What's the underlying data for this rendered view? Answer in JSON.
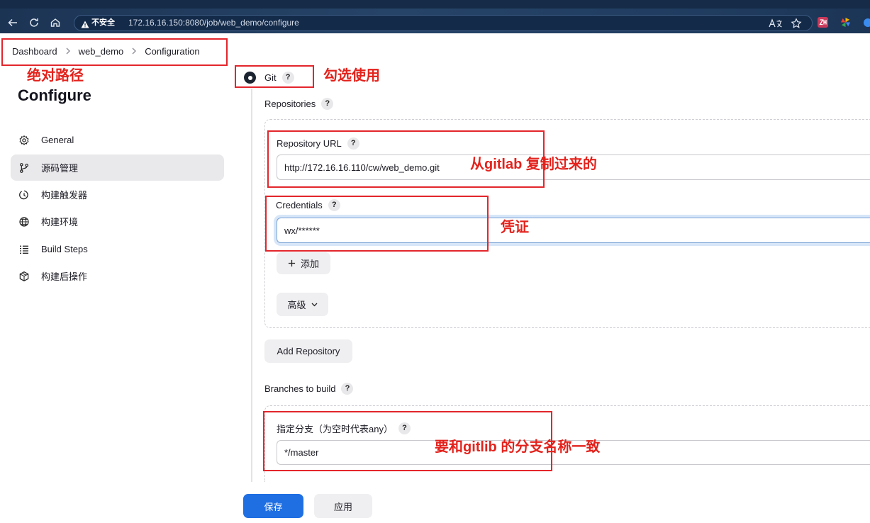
{
  "browser": {
    "security_label": "不安全",
    "url": "172.16.16.150:8080/job/web_demo/configure",
    "icons": [
      "arrow-left-icon",
      "reload-icon",
      "home-icon",
      "warning-icon",
      "read-aloud-icon",
      "star-icon",
      "extension-icon",
      "pinwheel-icon",
      "profile-icon"
    ]
  },
  "breadcrumb": {
    "items": [
      "Dashboard",
      "web_demo",
      "Configuration"
    ]
  },
  "sidebar": {
    "title": "Configure",
    "items": [
      {
        "label": "General",
        "icon": "gear-icon",
        "selected": false
      },
      {
        "label": "源码管理",
        "icon": "branch-icon",
        "selected": true
      },
      {
        "label": "构建触发器",
        "icon": "clock-icon",
        "selected": false
      },
      {
        "label": "构建环境",
        "icon": "globe-icon",
        "selected": false
      },
      {
        "label": "Build Steps",
        "icon": "list-icon",
        "selected": false
      },
      {
        "label": "构建后操作",
        "icon": "package-icon",
        "selected": false
      }
    ]
  },
  "scm": {
    "option_label": "Git",
    "option_selected": true,
    "repositories_label": "Repositories",
    "repository_url_label": "Repository URL",
    "repository_url_value": "http://172.16.16.110/cw/web_demo.git",
    "credentials_label": "Credentials",
    "credentials_value": "wx/******",
    "add_label": "添加",
    "advanced_label": "高级",
    "add_repository_label": "Add Repository",
    "branches_label": "Branches to build",
    "branch_specifier_label": "指定分支（为空时代表any）",
    "branch_specifier_value": "*/master"
  },
  "help_label": "?",
  "actions": {
    "save_label": "保存",
    "apply_label": "应用"
  },
  "annotations": {
    "absolute_path": "绝对路径",
    "check_to_use": "勾选使用",
    "copy_from_gitlab": "从gitlab 复制过来的",
    "credentials_note": "凭证",
    "branch_match": "要和gitlib 的分支名称一致"
  },
  "colors": {
    "annotation": "#e3221c",
    "primary_button": "#1f6fe3",
    "browser_bar": "#1f3a5c"
  }
}
